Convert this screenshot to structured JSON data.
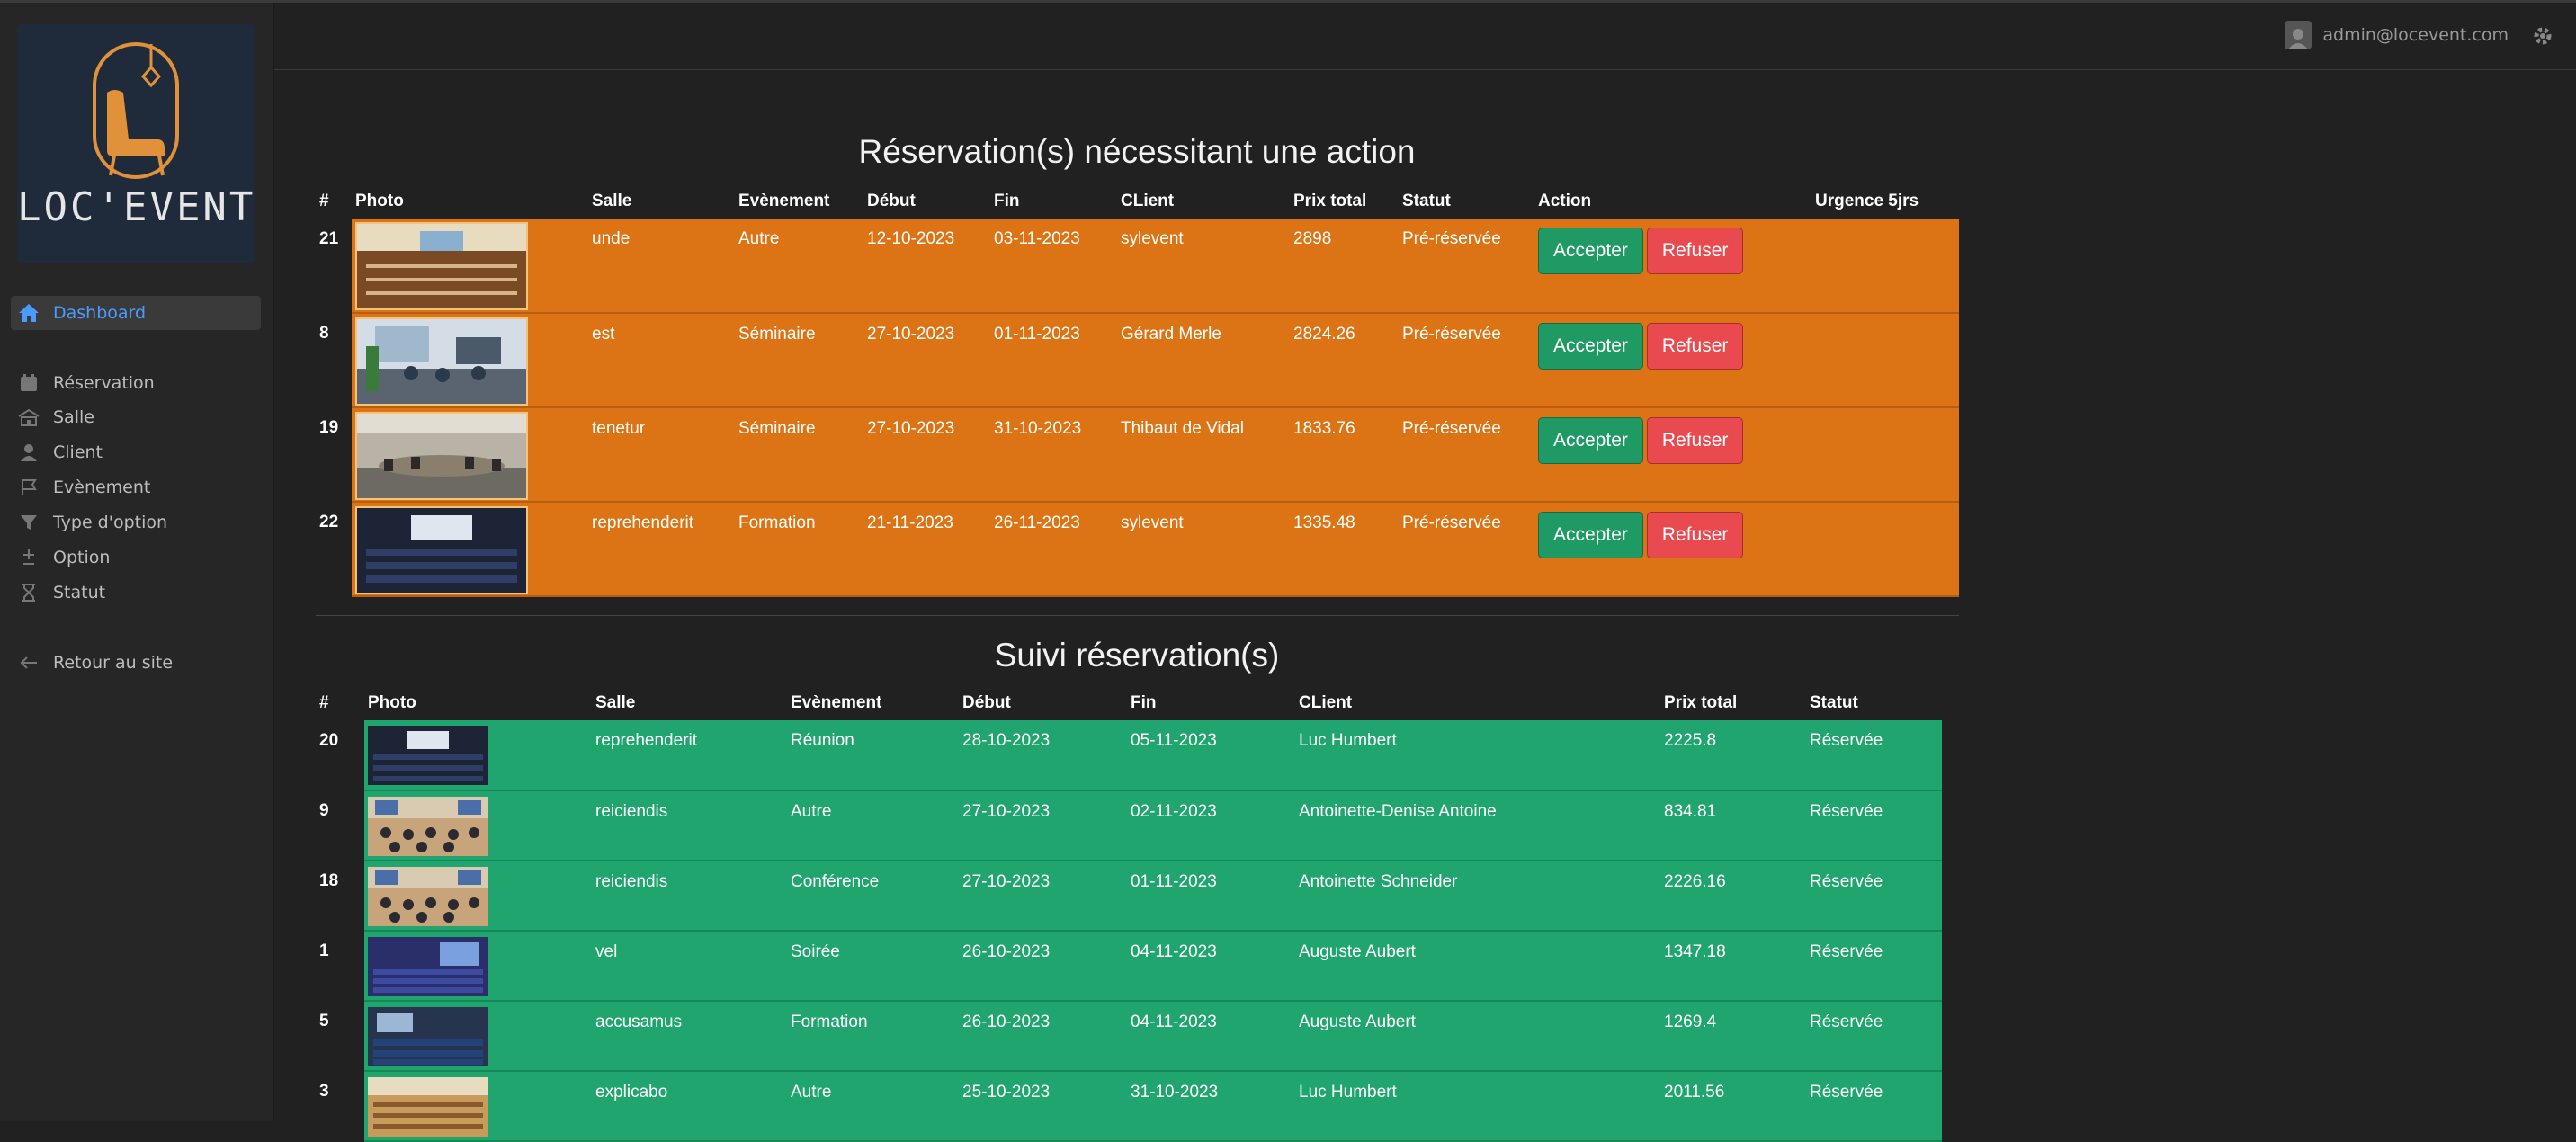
{
  "app": {
    "logo_text": "LOC'EVENT"
  },
  "sidebar": {
    "items": [
      {
        "label": "Dashboard",
        "icon": "home-icon",
        "active": true
      },
      {
        "label": "Réservation",
        "icon": "calendar-icon"
      },
      {
        "label": "Salle",
        "icon": "building-icon"
      },
      {
        "label": "Client",
        "icon": "user-icon"
      },
      {
        "label": "Evènement",
        "icon": "flag-icon"
      },
      {
        "label": "Type d'option",
        "icon": "filter-icon"
      },
      {
        "label": "Option",
        "icon": "plus-minus-icon"
      },
      {
        "label": "Statut",
        "icon": "hourglass-icon"
      },
      {
        "label": "Retour au site",
        "icon": "arrow-left-icon"
      }
    ]
  },
  "header": {
    "user_email": "admin@locevent.com"
  },
  "pending": {
    "title": "Réservation(s) nécessitant une action",
    "columns": [
      "#",
      "Photo",
      "Salle",
      "Evènement",
      "Début",
      "Fin",
      "CLient",
      "Prix total",
      "Statut",
      "Action",
      "Urgence 5jrs"
    ],
    "accept_label": "Accepter",
    "refuse_label": "Refuser",
    "rows": [
      {
        "id": "21",
        "salle": "unde",
        "evenement": "Autre",
        "debut": "12-10-2023",
        "fin": "03-11-2023",
        "client": "sylevent",
        "prix": "2898",
        "statut": "Pré-réservée",
        "urgence": ""
      },
      {
        "id": "8",
        "salle": "est",
        "evenement": "Séminaire",
        "debut": "27-10-2023",
        "fin": "01-11-2023",
        "client": "Gérard Merle",
        "prix": "2824.26",
        "statut": "Pré-réservée",
        "urgence": ""
      },
      {
        "id": "19",
        "salle": "tenetur",
        "evenement": "Séminaire",
        "debut": "27-10-2023",
        "fin": "31-10-2023",
        "client": "Thibaut de Vidal",
        "prix": "1833.76",
        "statut": "Pré-réservée",
        "urgence": ""
      },
      {
        "id": "22",
        "salle": "reprehenderit",
        "evenement": "Formation",
        "debut": "21-11-2023",
        "fin": "26-11-2023",
        "client": "sylevent",
        "prix": "1335.48",
        "statut": "Pré-réservée",
        "urgence": ""
      }
    ]
  },
  "tracking": {
    "title": "Suivi réservation(s)",
    "columns": [
      "#",
      "Photo",
      "Salle",
      "Evènement",
      "Début",
      "Fin",
      "CLient",
      "Prix total",
      "Statut"
    ],
    "rows": [
      {
        "id": "20",
        "salle": "reprehenderit",
        "evenement": "Réunion",
        "debut": "28-10-2023",
        "fin": "05-11-2023",
        "client": "Luc Humbert",
        "prix": "2225.8",
        "statut": "Réservée"
      },
      {
        "id": "9",
        "salle": "reiciendis",
        "evenement": "Autre",
        "debut": "27-10-2023",
        "fin": "02-11-2023",
        "client": "Antoinette-Denise Antoine",
        "prix": "834.81",
        "statut": "Réservée"
      },
      {
        "id": "18",
        "salle": "reiciendis",
        "evenement": "Conférence",
        "debut": "27-10-2023",
        "fin": "01-11-2023",
        "client": "Antoinette Schneider",
        "prix": "2226.16",
        "statut": "Réservée"
      },
      {
        "id": "1",
        "salle": "vel",
        "evenement": "Soirée",
        "debut": "26-10-2023",
        "fin": "04-11-2023",
        "client": "Auguste Aubert",
        "prix": "1347.18",
        "statut": "Réservée"
      },
      {
        "id": "5",
        "salle": "accusamus",
        "evenement": "Formation",
        "debut": "26-10-2023",
        "fin": "04-11-2023",
        "client": "Auguste Aubert",
        "prix": "1269.4",
        "statut": "Réservée"
      },
      {
        "id": "3",
        "salle": "explicabo",
        "evenement": "Autre",
        "debut": "25-10-2023",
        "fin": "31-10-2023",
        "client": "Luc Humbert",
        "prix": "2011.56",
        "statut": "Réservée"
      }
    ]
  },
  "colors": {
    "pending_row": "#dc7415",
    "tracking_row": "#20a56f",
    "accept": "#1f9a64",
    "refuse": "#e94a4f",
    "active_nav": "#4b9bff"
  }
}
